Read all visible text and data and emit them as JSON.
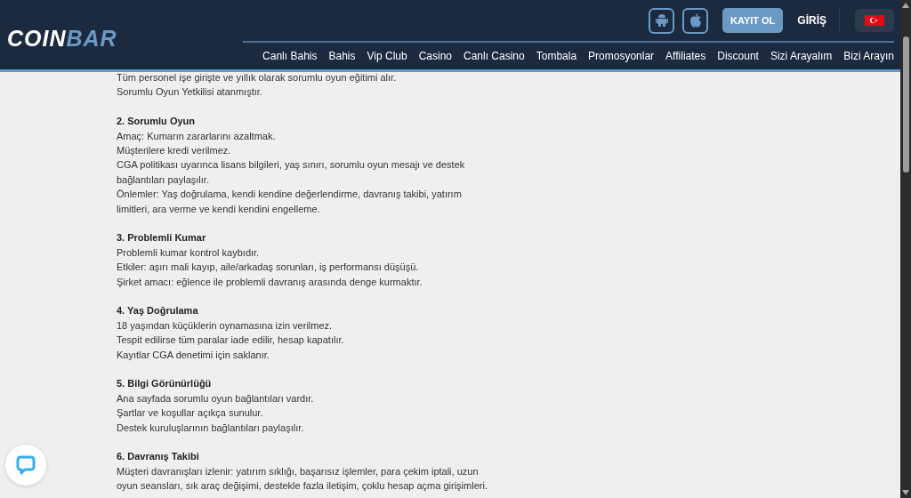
{
  "header": {
    "logo": {
      "part_1": "COIN",
      "part_2": "BAR"
    },
    "actions": {
      "register": "KAYIT OL",
      "login": "GİRİŞ"
    },
    "nav": [
      "Canlı Bahis",
      "Bahis",
      "Vip Club",
      "Casino",
      "Canlı Casino",
      "Tombala",
      "Promosyonlar",
      "Affiliates",
      "Discount",
      "Sizi Arayalım",
      "Bizi Arayın"
    ]
  },
  "sections": [
    {
      "lines": [
        "Tüm personel işe girişte ve yıllık olarak sorumlu oyun eğitimi alır.",
        "Sorumlu Oyun Yetkilisi atanmıştır."
      ]
    },
    {
      "heading": "2. Sorumlu Oyun",
      "lines": [
        "Amaç: Kumarın zararlarını azaltmak.",
        "Müşterilere kredi verilmez.",
        "CGA politikası uyarınca lisans bilgileri, yaş sınırı, sorumlu oyun mesajı ve destek bağlantıları paylaşılır.",
        "Önlemler: Yaş doğrulama, kendi kendine değerlendirme, davranış takibi, yatırım limitleri, ara verme ve kendi kendini engelleme."
      ]
    },
    {
      "heading": "3. Problemli Kumar",
      "lines": [
        "Problemli kumar kontrol kaybıdır.",
        "Etkiler: aşırı mali kayıp, aile/arkadaş sorunları, iş performansı düşüşü.",
        "Şirket amacı: eğlence ile problemli davranış arasında denge kurmaktır."
      ]
    },
    {
      "heading": "4. Yaş Doğrulama",
      "lines": [
        "18 yaşından küçüklerin oynamasına izin verilmez.",
        "Tespit edilirse tüm paralar iade edilir, hesap kapatılır.",
        "Kayıtlar CGA denetimi için saklanır."
      ]
    },
    {
      "heading": "5. Bilgi Görünürlüğü",
      "lines": [
        "Ana sayfada sorumlu oyun bağlantıları vardır.",
        "Şartlar ve koşullar açıkça sunulur.",
        "Destek kuruluşlarının bağlantıları paylaşılır."
      ]
    },
    {
      "heading": "6. Davranış Takibi",
      "lines": [
        "Müşteri davranışları izlenir: yatırım sıklığı, başarısız işlemler, para çekim iptali, uzun oyun seansları, sık araç değişimi, destekle fazla iletişim, çoklu hesap açma girişimleri."
      ]
    }
  ]
}
